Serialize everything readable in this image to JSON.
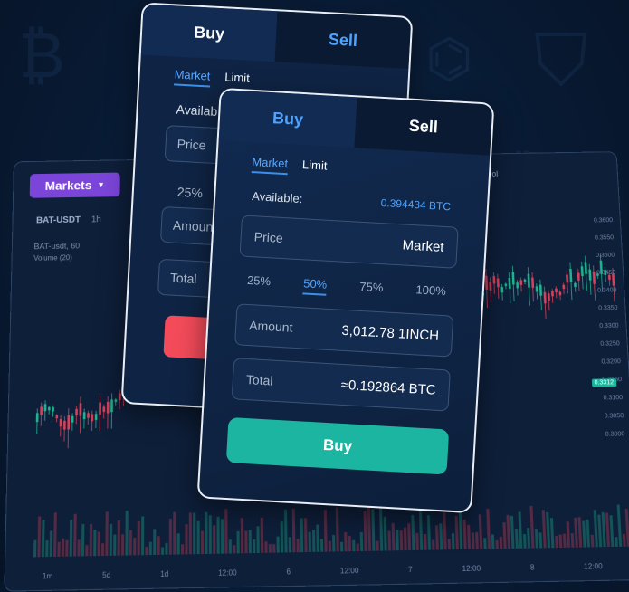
{
  "chart_panel": {
    "markets_label": "Markets",
    "pair": "BAT-USDT",
    "timeframes": "1h",
    "info_line": "BAT-usdt, 60",
    "volume_line": "Volume (20)",
    "vol_text": "527 vol",
    "right_ticks": [
      "0.3600",
      "0.3550",
      "0.3500",
      "0.3450",
      "0.3400",
      "0.3350",
      "0.3300",
      "0.3250",
      "0.3200",
      "0.3150",
      "0.3100",
      "0.3050",
      "0.3000"
    ],
    "price_tag": "0.3312",
    "bottom_ticks": [
      "1m",
      "5d",
      "1d",
      "12:00",
      "6",
      "12:00",
      "7",
      "12:00",
      "8",
      "12:00"
    ]
  },
  "back_card": {
    "tab_buy": "Buy",
    "tab_sell": "Sell",
    "sub_market": "Market",
    "sub_limit": "Limit",
    "available": "Availab",
    "price": "Price",
    "pct_25": "25%",
    "amount": "Amoun",
    "total": "Total"
  },
  "front_card": {
    "tab_buy": "Buy",
    "tab_sell": "Sell",
    "sub_market": "Market",
    "sub_limit": "Limit",
    "available_label": "Available:",
    "available_value": "0.394434 BTC",
    "price_label": "Price",
    "price_value": "Market",
    "pct": [
      "25%",
      "50%",
      "75%",
      "100%"
    ],
    "amount_label": "Amount",
    "amount_value": "3,012.78 1INCH",
    "total_label": "Total",
    "total_value": "≈0.192864  BTC",
    "buy_button": "Buy"
  },
  "colors": {
    "buy_green": "#1cb5a1",
    "sell_red": "#f34b5a",
    "accent_blue": "#4ea3ff",
    "markets_purple": "#7b45d9"
  }
}
